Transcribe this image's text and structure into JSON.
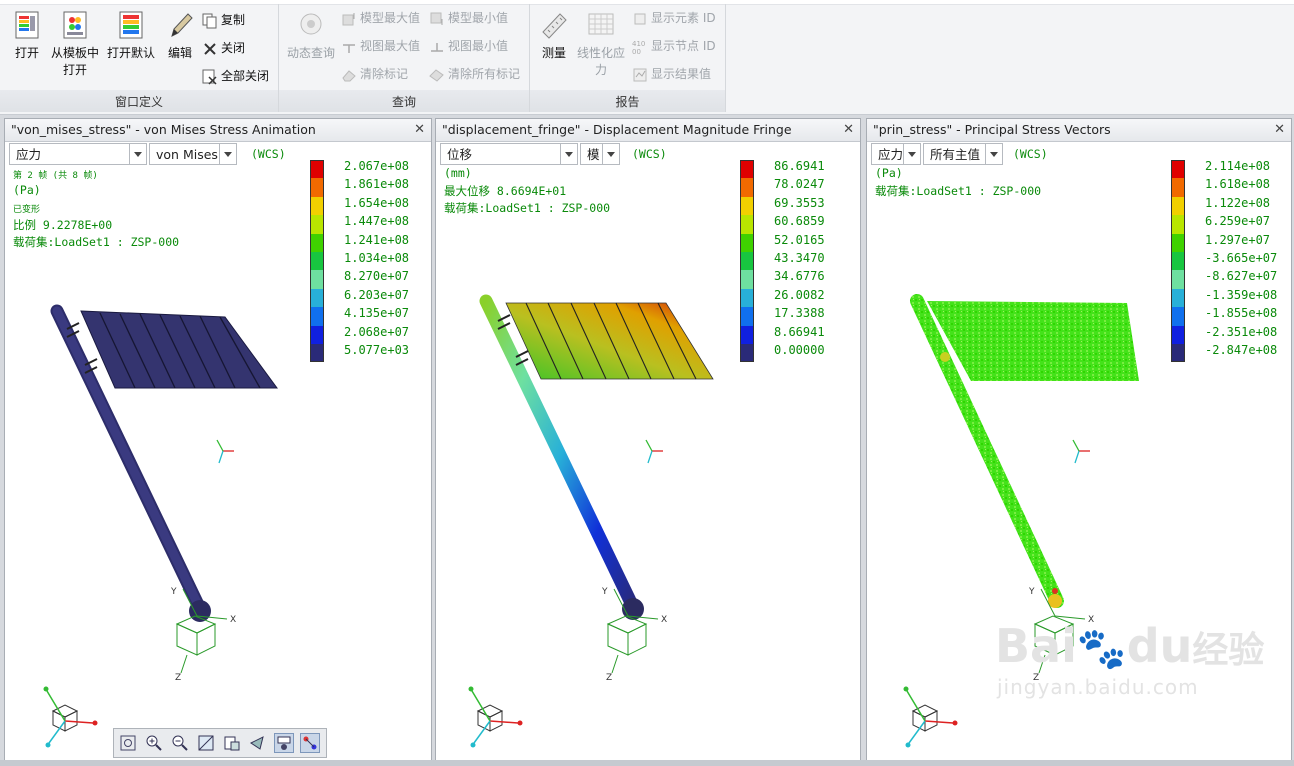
{
  "ribbon": {
    "groups": {
      "window_def": {
        "label": "窗口定义"
      },
      "query": {
        "label": "查询"
      },
      "report": {
        "label": "报告"
      }
    },
    "open": "打开",
    "from_template_l1": "从模板中",
    "from_template_l2": "打开",
    "open_default": "打开默认",
    "edit": "编辑",
    "copy": "复制",
    "close": "关闭",
    "close_all": "全部关闭",
    "dynamic_query": "动态查询",
    "model_max": "模型最大值",
    "model_min": "模型最小值",
    "view_max": "视图最大值",
    "view_min": "视图最小值",
    "clear_marks": "清除标记",
    "clear_all_marks": "清除所有标记",
    "measure": "测量",
    "linearize_l1": "线性化应",
    "linearize_l2": "力",
    "show_element_id": "显示元素 ID",
    "show_node_id": "显示节点 ID",
    "show_result": "显示结果值"
  },
  "panels": [
    {
      "title": "\"von_mises_stress\" - von Mises Stress Animation",
      "dd1": "应力",
      "dd2": "von Mises",
      "wcs": "(WCS)",
      "info": [
        "第 2 帧 (共 8 帧)",
        "(Pa)",
        "已变形",
        "比例  9.2278E+00",
        "载荷集:LoadSet1 :  ZSP-000"
      ],
      "legend": [
        "2.067e+08",
        "1.861e+08",
        "1.654e+08",
        "1.447e+08",
        "1.241e+08",
        "1.034e+08",
        "8.270e+07",
        "6.203e+07",
        "4.135e+07",
        "2.068e+07",
        "5.077e+03"
      ]
    },
    {
      "title": "\"displacement_fringe\" - Displacement Magnitude Fringe",
      "dd1": "位移",
      "dd2": "模",
      "wcs": "(WCS)",
      "info": [
        "(mm)",
        "最大位移  8.6694E+01",
        "载荷集:LoadSet1 :  ZSP-000"
      ],
      "legend": [
        "86.6941",
        "78.0247",
        "69.3553",
        "60.6859",
        "52.0165",
        "43.3470",
        "34.6776",
        "26.0082",
        "17.3388",
        "8.66941",
        "0.00000"
      ]
    },
    {
      "title": "\"prin_stress\" - Principal Stress Vectors",
      "dd1": "应力",
      "dd2": "所有主值",
      "wcs": "(WCS)",
      "info": [
        "(Pa)",
        "载荷集:LoadSet1 :  ZSP-000"
      ],
      "legend": [
        "2.114e+08",
        "1.618e+08",
        "1.122e+08",
        "6.259e+07",
        "1.297e+07",
        "-3.665e+07",
        "-8.627e+07",
        "-1.359e+08",
        "-1.855e+08",
        "-2.351e+08",
        "-2.847e+08"
      ]
    }
  ],
  "legend_colors": [
    "#e00000",
    "#f26a00",
    "#f2d000",
    "#b9e600",
    "#3fd200",
    "#18c640",
    "#6ee0a0",
    "#28b0d8",
    "#1070ee",
    "#1020e0",
    "#2a2a78"
  ],
  "axis_labels": {
    "x": "X",
    "y": "Y",
    "z": "Z"
  },
  "watermark": {
    "brand": "Bai",
    "brand_tail": "du",
    "cn": "经验",
    "url": "jingyan.baidu.com"
  }
}
